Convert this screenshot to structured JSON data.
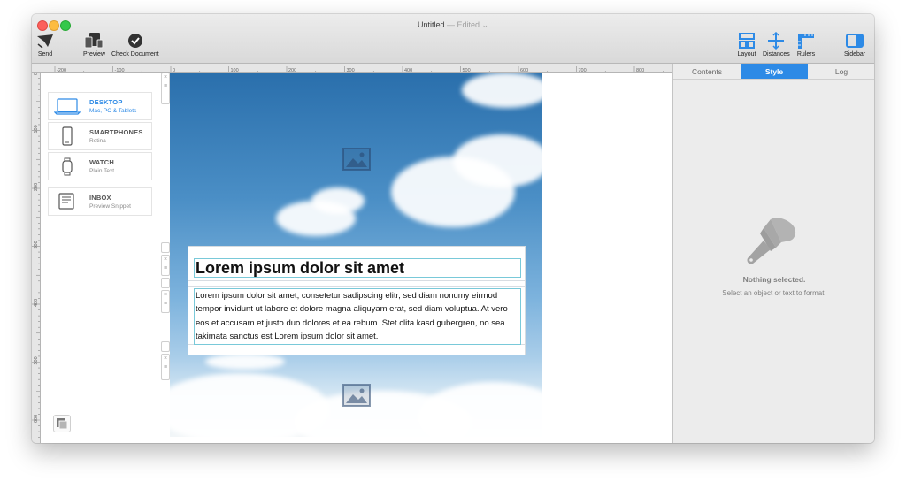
{
  "window": {
    "title": "Untitled",
    "edited_label": "— Edited ⌄"
  },
  "toolbar": {
    "send": "Send",
    "preview": "Preview",
    "check_document": "Check Document",
    "layout": "Layout",
    "distances": "Distances",
    "rulers": "Rulers",
    "sidebar": "Sidebar"
  },
  "ruler": {
    "top_labels": [
      "-200",
      "-100",
      "0",
      "100",
      "200",
      "300",
      "400",
      "500",
      "600",
      "700",
      "800"
    ],
    "left_labels": [
      "0",
      "100",
      "200",
      "300",
      "400",
      "500",
      "600"
    ]
  },
  "devices": [
    {
      "name": "DESKTOP",
      "sub": "Mac, PC & Tablets",
      "icon": "laptop-icon",
      "active": true
    },
    {
      "name": "SMARTPHONES",
      "sub": "Retina",
      "icon": "smartphone-icon",
      "active": false
    },
    {
      "name": "WATCH",
      "sub": "Plain Text",
      "icon": "watch-icon",
      "active": false
    },
    {
      "name": "INBOX",
      "sub": "Preview Snippet",
      "icon": "inbox-icon",
      "active": false
    }
  ],
  "content": {
    "headline": "Lorem ipsum dolor sit amet",
    "body": "Lorem ipsum dolor sit amet, consetetur sadipscing elitr, sed diam nonumy eirmod tempor invidunt ut labore et dolore magna aliquyam erat, sed diam voluptua. At vero eos et accusam et justo duo dolores et ea rebum. Stet clita kasd gubergren, no sea takimata sanctus est Lorem ipsum dolor sit amet."
  },
  "sidebar": {
    "tabs": [
      "Contents",
      "Style",
      "Log"
    ],
    "active_tab": "Style",
    "empty_title": "Nothing selected.",
    "empty_subtitle": "Select an object or text to format."
  },
  "colors": {
    "accent": "#2d8ae6",
    "guide": "#79c9d9"
  }
}
